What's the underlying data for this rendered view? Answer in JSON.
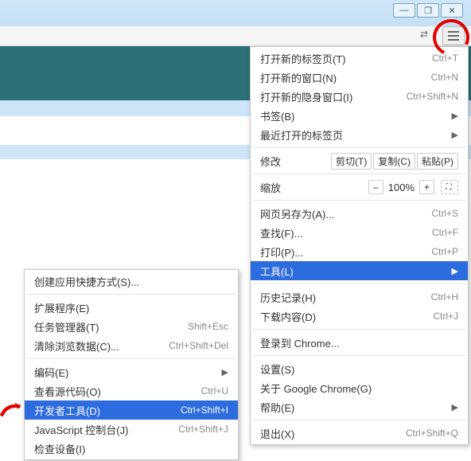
{
  "window_controls": {
    "min": "—",
    "max": "❐",
    "close": "✕"
  },
  "toolbar": {
    "translate_icon": "⇄"
  },
  "menu": {
    "new_tab": {
      "label": "打开新的标签页(T)",
      "accel": "Ctrl+T"
    },
    "new_window": {
      "label": "打开新的窗口(N)",
      "accel": "Ctrl+N"
    },
    "new_incognito": {
      "label": "打开新的隐身窗口(I)",
      "accel": "Ctrl+Shift+N"
    },
    "bookmarks": {
      "label": "书签(B)"
    },
    "recent_tabs": {
      "label": "最近打开的标签页"
    },
    "edit_label": "修改",
    "edit_cut": "剪切(T)",
    "edit_copy": "复制(C)",
    "edit_paste": "粘贴(P)",
    "zoom_label": "缩放",
    "zoom_minus": "–",
    "zoom_pct": "100%",
    "zoom_plus": "+",
    "save_as": {
      "label": "网页另存为(A)...",
      "accel": "Ctrl+S"
    },
    "find": {
      "label": "查找(F)...",
      "accel": "Ctrl+F"
    },
    "print": {
      "label": "打印(P)...",
      "accel": "Ctrl+P"
    },
    "tools": {
      "label": "工具(L)"
    },
    "history": {
      "label": "历史记录(H)",
      "accel": "Ctrl+H"
    },
    "downloads": {
      "label": "下载内容(D)",
      "accel": "Ctrl+J"
    },
    "signin": {
      "label": "登录到 Chrome..."
    },
    "settings": {
      "label": "设置(S)"
    },
    "about": {
      "label": "关于 Google Chrome(G)"
    },
    "help": {
      "label": "帮助(E)"
    },
    "exit": {
      "label": "退出(X)",
      "accel": "Ctrl+Shift+Q"
    }
  },
  "submenu": {
    "create_shortcut": {
      "label": "创建应用快捷方式(S)..."
    },
    "extensions": {
      "label": "扩展程序(E)"
    },
    "task_manager": {
      "label": "任务管理器(T)",
      "accel": "Shift+Esc"
    },
    "clear_data": {
      "label": "清除浏览数据(C)...",
      "accel": "Ctrl+Shift+Del"
    },
    "encoding": {
      "label": "编码(E)"
    },
    "view_source": {
      "label": "查看源代码(O)",
      "accel": "Ctrl+U"
    },
    "dev_tools": {
      "label": "开发者工具(D)",
      "accel": "Ctrl+Shift+I"
    },
    "js_console": {
      "label": "JavaScript 控制台(J)",
      "accel": "Ctrl+Shift+J"
    },
    "inspect_devices": {
      "label": "检查设备(I)"
    }
  }
}
